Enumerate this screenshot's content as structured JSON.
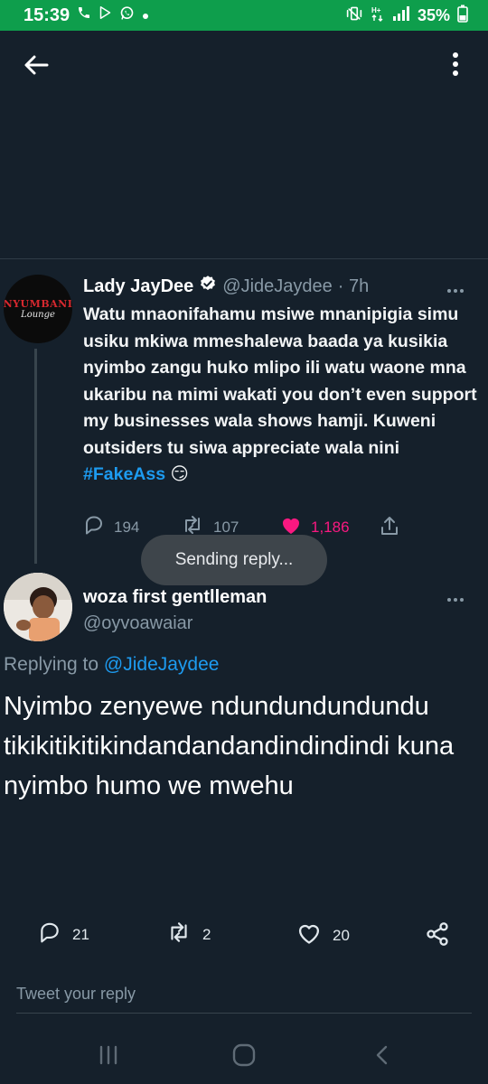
{
  "status_bar": {
    "time": "15:39",
    "left_icons": [
      "phone-icon",
      "play-store-icon",
      "whatsapp-icon",
      "dot-icon"
    ],
    "right_icons": [
      "mute-vibrate-icon",
      "data-icon",
      "signal-icon"
    ],
    "battery": "35%",
    "bar_color": "#0e9e4c"
  },
  "header": {
    "back_icon": "arrow-left-icon",
    "more_icon": "more-vertical-icon"
  },
  "parent_tweet": {
    "avatar_logo_top": "NYUMBANI",
    "avatar_logo_bottom": "Lounge",
    "name": "Lady JayDee",
    "verified_icon": "verified-badge-icon",
    "handle": "@JideJaydee",
    "time": "· 7h",
    "text": "Watu mnaonifahamu msiwe mnanipigia simu usiku mkiwa mmeshalewa baada ya kusikia nyimbo zangu huko mlipo ili watu waone mna ukaribu na mimi wakati you don’t even support my businesses wala shows hamji. Kuweni outsiders tu siwa appreciate wala nini",
    "hashtag": "#FakeAss",
    "emoji": "😏",
    "replies": "194",
    "retweets": "107",
    "likes": "1,186",
    "liked": true
  },
  "toast": {
    "text": "Sending reply..."
  },
  "reply_tweet": {
    "name": "woza first gentlleman",
    "handle": "@oyvoawaiar",
    "replying_to_label": "Replying to",
    "replying_to_handle": "@JideJaydee",
    "text": "Nyimbo zenyewe ndundundundundu tikikitikitikindandandandindindindi kuna nyimbo humo we mwehu",
    "replies": "21",
    "retweets": "2",
    "likes": "20"
  },
  "compose": {
    "placeholder": "Tweet your reply"
  },
  "colors": {
    "background": "#15202b",
    "accent": "#1d9bf0",
    "like": "#f91880",
    "muted": "#8899a6"
  }
}
